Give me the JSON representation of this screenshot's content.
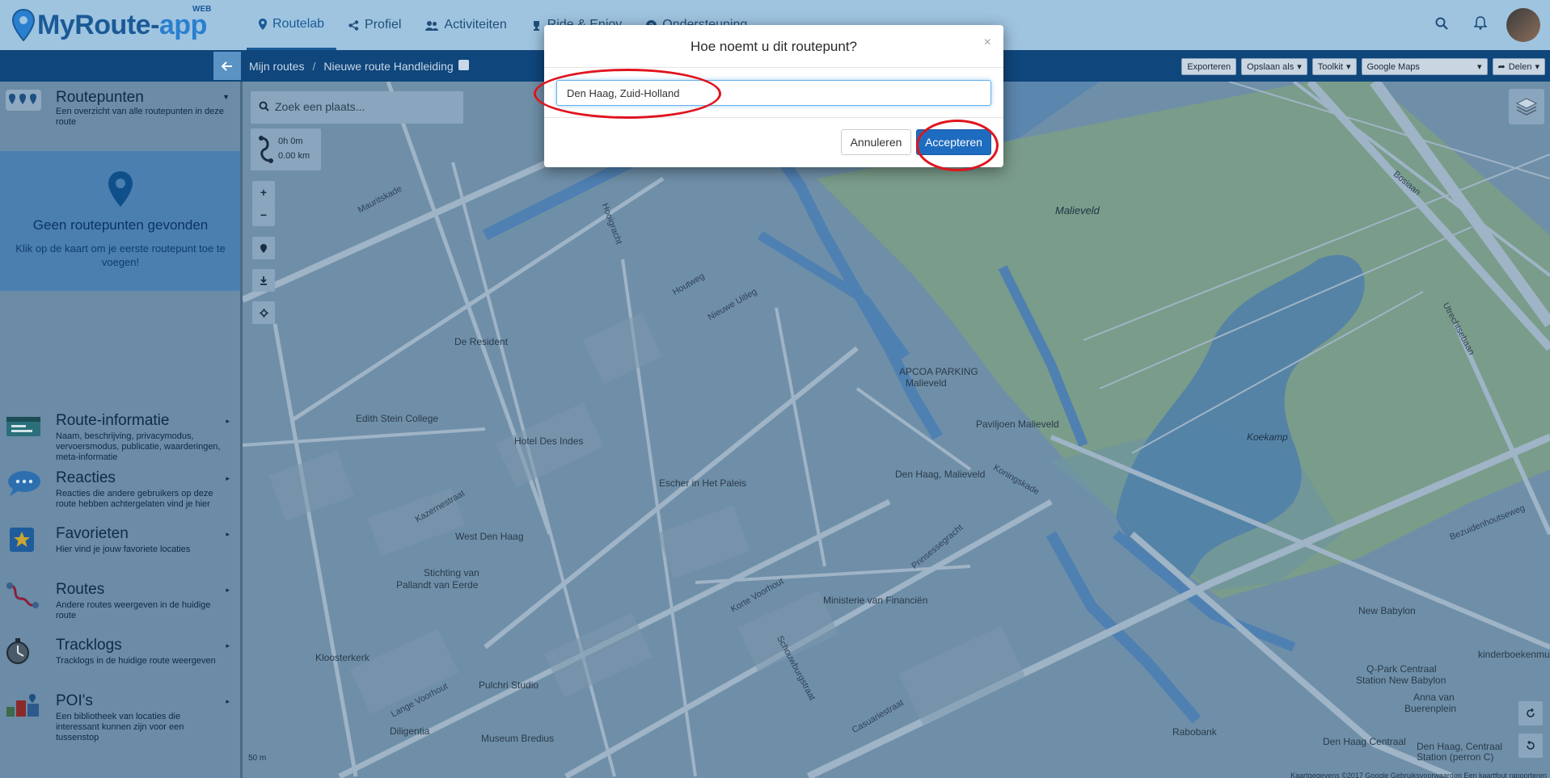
{
  "app": {
    "logo_prefix": "MyRoute",
    "logo_dash": "-",
    "logo_suffix": "app",
    "logo_badge": "WEB"
  },
  "nav": [
    {
      "label": "Routelab",
      "icon": "map-marker-icon",
      "active": true
    },
    {
      "label": "Profiel",
      "icon": "share-icon"
    },
    {
      "label": "Activiteiten",
      "icon": "users-icon"
    },
    {
      "label": "Ride & Enjoy",
      "icon": "trophy-icon"
    },
    {
      "label": "Ondersteuning",
      "icon": "question-icon"
    }
  ],
  "topbar_icons": [
    "search-icon",
    "bell-icon",
    "avatar"
  ],
  "breadcrumb": {
    "root": "Mijn routes",
    "separator": "/",
    "current": "Nieuwe route Handleiding"
  },
  "toolbar": {
    "export": "Exporteren",
    "save_as": "Opslaan als",
    "toolkit": "Toolkit",
    "map_type": "Google Maps",
    "share": "Delen"
  },
  "sidebar": {
    "routepoints": {
      "title": "Routepunten",
      "desc": "Een overzicht van alle routepunten in deze route"
    },
    "empty": {
      "title": "Geen routepunten gevonden",
      "desc": "Klik op de kaart om je eerste routepunt toe te voegen!"
    },
    "items": [
      {
        "title": "Route-informatie",
        "desc": "Naam, beschrijving, privacymodus, vervoersmodus, publicatie, waarderingen, meta-informatie",
        "icon": "info-card-icon"
      },
      {
        "title": "Reacties",
        "desc": "Reacties die andere gebruikers op deze route hebben achtergelaten vind je hier",
        "icon": "speech-bubble-icon"
      },
      {
        "title": "Favorieten",
        "desc": "Hier vind je jouw favoriete locaties",
        "icon": "star-icon"
      },
      {
        "title": "Routes",
        "desc": "Andere routes weergeven in de huidige route",
        "icon": "route-icon"
      },
      {
        "title": "Tracklogs",
        "desc": "Tracklogs in de huidige route weergeven",
        "icon": "stopwatch-icon"
      },
      {
        "title": "POI's",
        "desc": "Een bibliotheek van locaties die interessant kunnen zijn voor een tussenstop",
        "icon": "poi-icon"
      }
    ]
  },
  "map": {
    "search_placeholder": "Zoek een plaats...",
    "stats": {
      "time": "0h 0m",
      "distance": "0.00 km"
    },
    "controls": [
      "+",
      "−"
    ],
    "scale": "50 m",
    "copyright": "Kaartgegevens ©2017 Google   Gebruiksvoorwaarden   Een kaartfout rapporteren",
    "labels": [
      {
        "text": "Malieveld",
        "cls": "it"
      },
      {
        "text": "De Resident",
        "cls": "poi"
      },
      {
        "text": "APCOA PARKING",
        "cls": "poi"
      },
      {
        "text": "Malieveld",
        "cls": "poi"
      },
      {
        "text": "Paviljoen Malieveld",
        "cls": "poi"
      },
      {
        "text": "Edith Stein College",
        "cls": "poi"
      },
      {
        "text": "Hotel Des Indes",
        "cls": "poi"
      },
      {
        "text": "Koekamp",
        "cls": "it"
      },
      {
        "text": "Den Haag, Malieveld",
        "cls": "poi"
      },
      {
        "text": "Escher in Het Paleis",
        "cls": "poi"
      },
      {
        "text": "West Den Haag",
        "cls": "poi"
      },
      {
        "text": "Stichting van",
        "cls": "poi"
      },
      {
        "text": "Pallandt van Eerde",
        "cls": "poi"
      },
      {
        "text": "Ministerie van Financiën",
        "cls": "poi"
      },
      {
        "text": "New Babylon",
        "cls": "poi"
      },
      {
        "text": "kinderboekenmus",
        "cls": "poi"
      },
      {
        "text": "Q-Park Centraal",
        "cls": "poi"
      },
      {
        "text": "Station New Babylon",
        "cls": "poi"
      },
      {
        "text": "Anna van",
        "cls": "poi"
      },
      {
        "text": "Buerenplein",
        "cls": "poi"
      },
      {
        "text": "Kloosterkerk",
        "cls": "poi"
      },
      {
        "text": "Pulchri Studio",
        "cls": "poi"
      },
      {
        "text": "Diligentia",
        "cls": "poi"
      },
      {
        "text": "Museum Bredius",
        "cls": "poi"
      },
      {
        "text": "Rabobank",
        "cls": "poi"
      },
      {
        "text": "Den Haag Centraal",
        "cls": "poi"
      },
      {
        "text": "Den Haag, Centraal",
        "cls": "poi"
      },
      {
        "text": "Station (perron C)",
        "cls": "poi"
      },
      {
        "text": "Utrechtsebaan",
        "cls": "street"
      },
      {
        "text": "Bezuidenhoutseweg",
        "cls": "street"
      },
      {
        "text": "Koningskade",
        "cls": "street"
      },
      {
        "text": "Mauritskade",
        "cls": "street"
      },
      {
        "text": "Bosiaan",
        "cls": "street"
      },
      {
        "text": "Lange Voorhout",
        "cls": "street"
      },
      {
        "text": "Korte Voorhout",
        "cls": "street"
      },
      {
        "text": "Prinsessegracht",
        "cls": "street"
      },
      {
        "text": "Kazernestraat",
        "cls": "street"
      },
      {
        "text": "Houtweg",
        "cls": "street"
      },
      {
        "text": "Nieuwe Uitleg",
        "cls": "street"
      },
      {
        "text": "Hooigracht",
        "cls": "street"
      },
      {
        "text": "Schouwburgstraat",
        "cls": "street"
      },
      {
        "text": "Casuariestraat",
        "cls": "street"
      }
    ]
  },
  "dialog": {
    "title": "Hoe noemt u dit routepunt?",
    "close": "×",
    "input_value": "Den Haag, Zuid-Holland",
    "cancel": "Annuleren",
    "accept": "Accepteren"
  },
  "colors": {
    "brand": "#1e6ab0",
    "accept_button": "#1e6cc0",
    "annotation": "#e0141e",
    "overlay": "#6f8fa8"
  }
}
